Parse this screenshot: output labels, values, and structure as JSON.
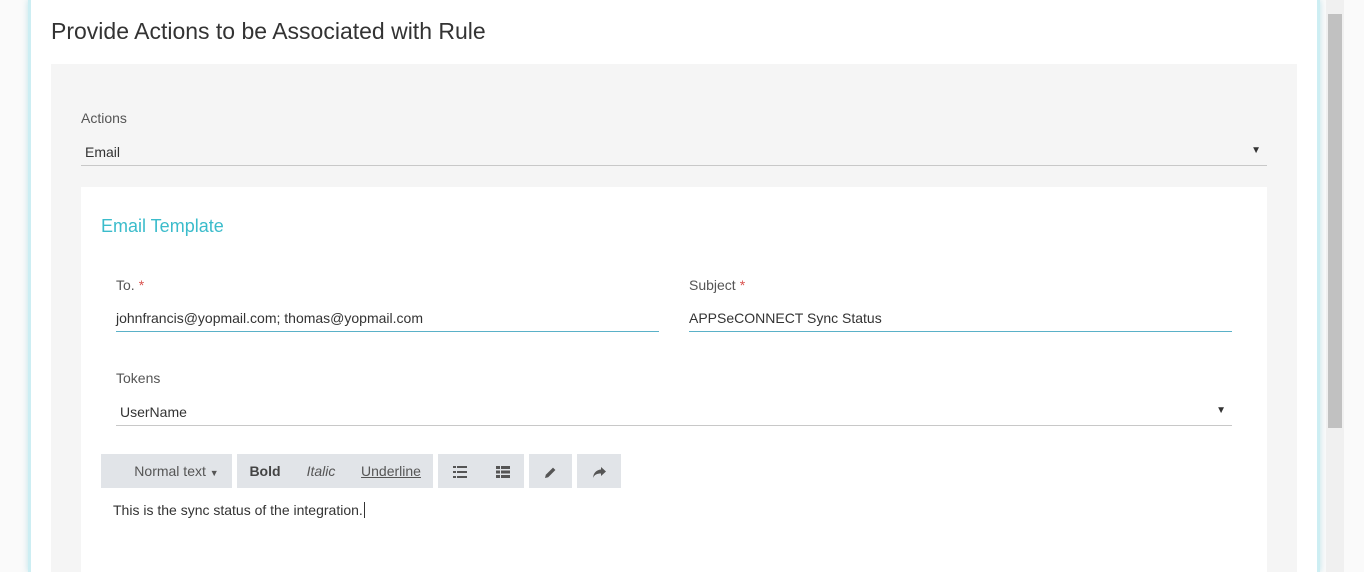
{
  "page": {
    "title": "Provide Actions to be Associated with Rule"
  },
  "actions": {
    "label": "Actions",
    "selected": "Email"
  },
  "email_template": {
    "title": "Email Template",
    "to": {
      "label": "To.",
      "required_mark": "*",
      "value": "johnfrancis@yopmail.com; thomas@yopmail.com"
    },
    "subject": {
      "label": "Subject",
      "required_mark": "*",
      "value": "APPSeCONNECT Sync Status"
    },
    "tokens": {
      "label": "Tokens",
      "selected": "UserName"
    }
  },
  "toolbar": {
    "text_style": "Normal text",
    "bold": "Bold",
    "italic": "Italic",
    "underline": "Underline",
    "icons": [
      "unordered-list-icon",
      "ordered-list-icon",
      "pencil-icon",
      "redo-icon"
    ]
  },
  "editor": {
    "content": "This is the sync status of the integration."
  },
  "colors": {
    "accent": "#3bbccb",
    "input_underline": "#5ab1c8",
    "required": "#d9534f",
    "toolbar_bg": "#e1e4e8"
  }
}
